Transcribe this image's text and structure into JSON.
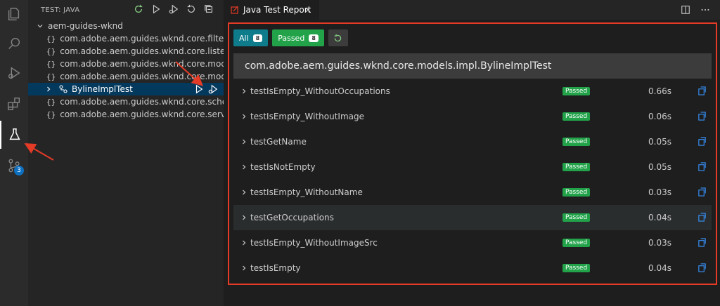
{
  "sidebar": {
    "title": "TEST: JAVA",
    "project": "aem-guides-wknd",
    "packages": [
      "com.adobe.aem.guides.wknd.core.filters",
      "com.adobe.aem.guides.wknd.core.liste...",
      "com.adobe.aem.guides.wknd.core.mod...",
      "com.adobe.aem.guides.wknd.core.mod..."
    ],
    "selected_class": "BylineImplTest",
    "more_packages": [
      "com.adobe.aem.guides.wknd.core.sche...",
      "com.adobe.aem.guides.wknd.core.servl..."
    ]
  },
  "activity": {
    "scm_badge": "3"
  },
  "editor": {
    "tab_title": "Java Test Report"
  },
  "report": {
    "filter_all_label": "All",
    "filter_all_count": "8",
    "filter_passed_label": "Passed",
    "filter_passed_count": "8",
    "class_name": "com.adobe.aem.guides.wknd.core.models.impl.BylineImplTest",
    "tests": [
      {
        "name": "testIsEmpty_WithoutOccupations",
        "status": "Passed",
        "time": "0.66s"
      },
      {
        "name": "testIsEmpty_WithoutImage",
        "status": "Passed",
        "time": "0.06s"
      },
      {
        "name": "testGetName",
        "status": "Passed",
        "time": "0.05s"
      },
      {
        "name": "testIsNotEmpty",
        "status": "Passed",
        "time": "0.05s"
      },
      {
        "name": "testIsEmpty_WithoutName",
        "status": "Passed",
        "time": "0.03s"
      },
      {
        "name": "testGetOccupations",
        "status": "Passed",
        "time": "0.04s"
      },
      {
        "name": "testIsEmpty_WithoutImageSrc",
        "status": "Passed",
        "time": "0.03s"
      },
      {
        "name": "testIsEmpty",
        "status": "Passed",
        "time": "0.04s"
      }
    ]
  },
  "colors": {
    "highlight_border": "#e33b26",
    "passed_green": "#22a34a",
    "all_teal": "#0f7c8c",
    "selection_blue": "#04395e"
  }
}
